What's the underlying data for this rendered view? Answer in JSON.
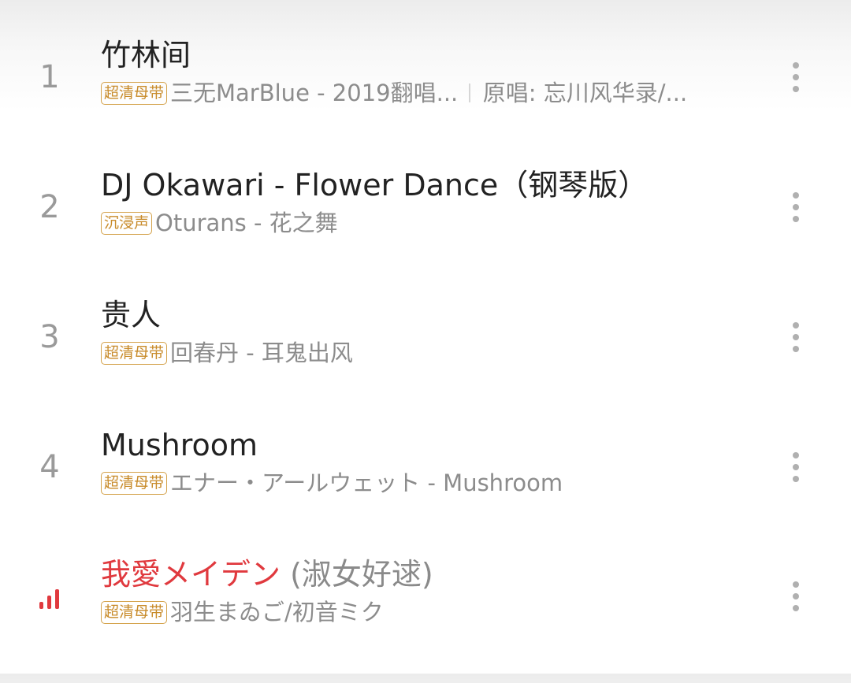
{
  "songs": [
    {
      "index": "1",
      "title": "竹林间",
      "title_extra": "",
      "badge": "超清母带",
      "artist": "三无MarBlue - 2019翻唱...",
      "original": "原唱: 忘川风华录/...",
      "playing": false
    },
    {
      "index": "2",
      "title": "DJ Okawari - Flower Dance（钢琴版）",
      "title_extra": "",
      "badge": "沉浸声",
      "artist": "Oturans - 花之舞",
      "original": "",
      "playing": false
    },
    {
      "index": "3",
      "title": "贵人",
      "title_extra": "",
      "badge": "超清母带",
      "artist": "回春丹 - 耳鬼出风",
      "original": "",
      "playing": false
    },
    {
      "index": "4",
      "title": "Mushroom",
      "title_extra": "",
      "badge": "超清母带",
      "artist": "エナー・アールウェット - Mushroom",
      "original": "",
      "playing": false
    },
    {
      "index": "",
      "title": "我愛メイデン",
      "title_extra": " (淑女好逑)",
      "badge": "超清母带",
      "artist": "羽生まゐご/初音ミク",
      "original": "",
      "playing": true,
      "indicator_icon": "now-playing-bars-icon"
    }
  ],
  "colors": {
    "playing_accent": "#e0393e",
    "badge_gold": "#c88b2a",
    "title_text": "#222222",
    "secondary_text": "#8c8c8c",
    "index_text": "#9a9a9a"
  },
  "icons": {
    "more": "more-vertical-icon"
  }
}
